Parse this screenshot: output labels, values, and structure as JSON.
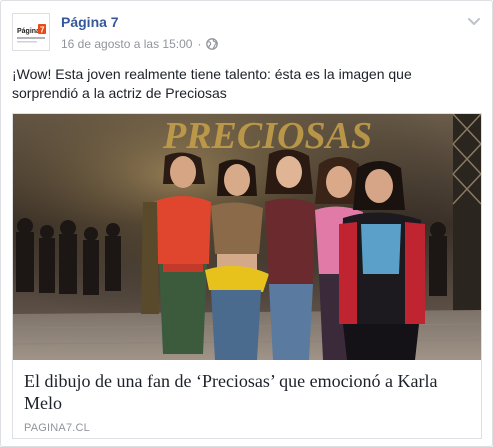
{
  "post": {
    "page_name": "Página 7",
    "timestamp": "16 de agosto a las 15:00",
    "separator": "·",
    "privacy_icon": "globe-icon",
    "menu_icon": "chevron-down-icon",
    "text": "¡Wow! Esta joven realmente tiene talento: ésta es la imagen que\nsorprendió a la actriz de Preciosas"
  },
  "avatar": {
    "logo_text": "Página",
    "logo_number": "7",
    "brand_color": "#e74c16"
  },
  "link_card": {
    "image_banner_text": "PRECIOSAS",
    "title": "El dibujo de una fan de ‘Preciosas’ que emocionó a Karla Melo",
    "domain": "PAGINA7.CL"
  },
  "colors": {
    "page_name": "#365899",
    "meta": "#90949c",
    "text": "#1d2129"
  }
}
